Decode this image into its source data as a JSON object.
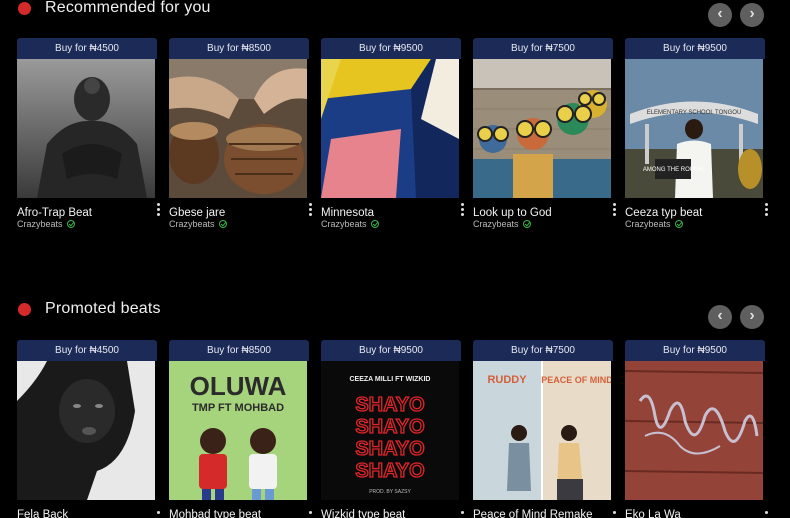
{
  "recommended": {
    "title": "Recommended for you",
    "cards": [
      {
        "buy": "Buy for ₦4500",
        "title": "Afro-Trap Beat",
        "seller": "Crazybeats"
      },
      {
        "buy": "Buy for ₦8500",
        "title": "Gbese jare",
        "seller": "Crazybeats"
      },
      {
        "buy": "Buy for ₦9500",
        "title": "Minnesota",
        "seller": "Crazybeats"
      },
      {
        "buy": "Buy for ₦7500",
        "title": "Look up to God",
        "seller": "Crazybeats"
      },
      {
        "buy": "Buy for ₦9500",
        "title": "Ceeza typ beat",
        "seller": "Crazybeats"
      }
    ]
  },
  "promoted": {
    "title": "Promoted beats",
    "cards": [
      {
        "buy": "Buy for ₦4500",
        "title": "Fela Back"
      },
      {
        "buy": "Buy for ₦8500",
        "title": "Mohbad type beat"
      },
      {
        "buy": "Buy for ₦9500",
        "title": "Wizkid type beat"
      },
      {
        "buy": "Buy for ₦7500",
        "title": "Peace of Mind Remake"
      },
      {
        "buy": "Buy for ₦9500",
        "title": "Eko La Wa"
      }
    ]
  },
  "covers": {
    "oluwa_title": "OLUWA",
    "oluwa_sub": "TMP FT MOHBAD",
    "shayo_artist": "CEEZA MILLI FT WIZKID",
    "shayo_word": "SHAYO",
    "shayo_prod": "PROD. BY SAZSY",
    "peace_left": "RUDDY",
    "peace_right": "PEACE OF MIND",
    "ceeza_sign": "AMONG THE ROUGH",
    "ceeza_arch": "ELEMENTARY SCHOOL TONGOU"
  },
  "colors": {
    "accent_dot": "#d42a2a",
    "buy_bar": "#1c2a57",
    "verified": "#39b54a"
  }
}
